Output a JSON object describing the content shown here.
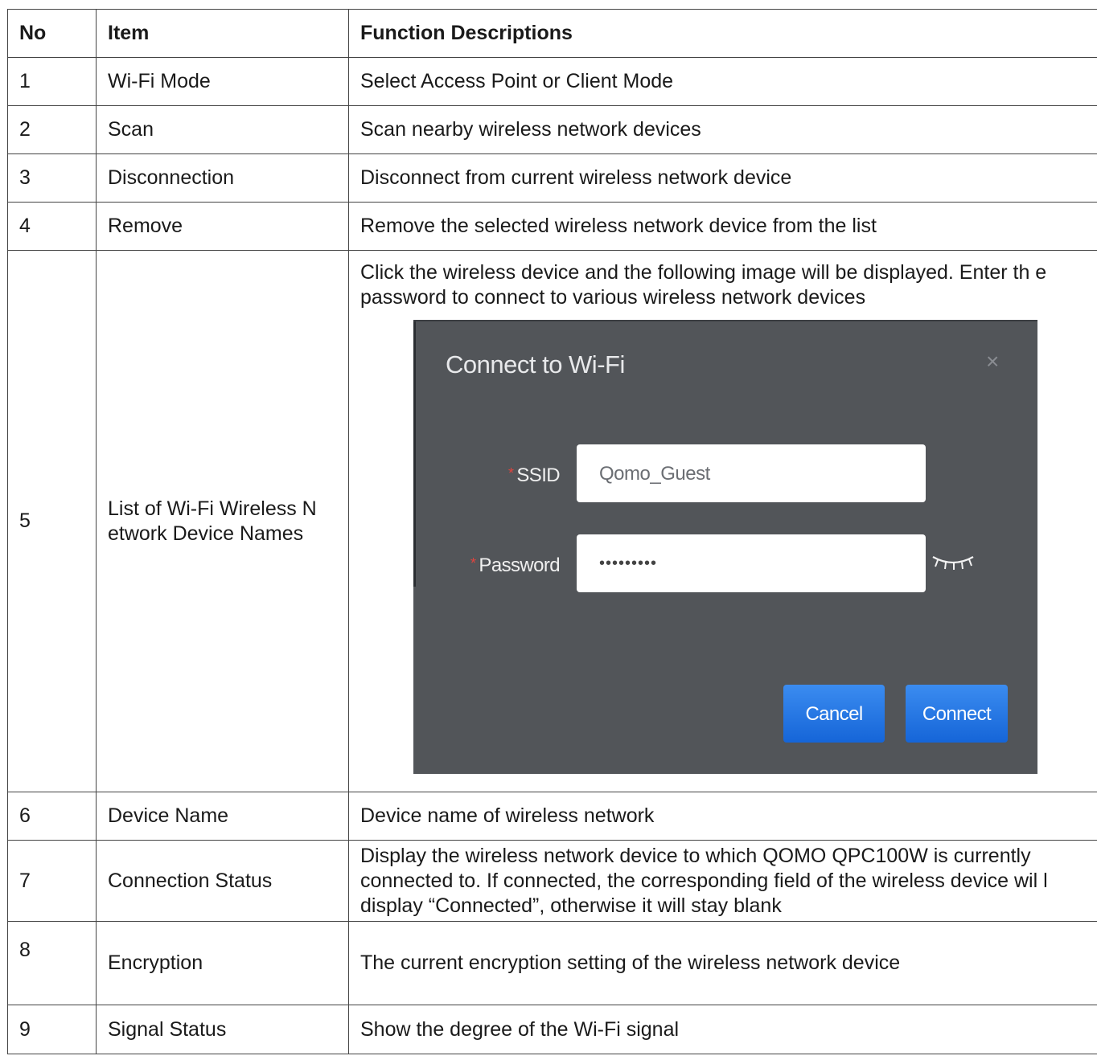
{
  "table": {
    "headers": {
      "no": "No",
      "item": "Item",
      "description": "Function Descriptions"
    },
    "rows": [
      {
        "no": "1",
        "item": "Wi-Fi Mode",
        "description": "Select Access Point or Client Mode"
      },
      {
        "no": "2",
        "item": "Scan",
        "description": "Scan nearby wireless network devices"
      },
      {
        "no": "3",
        "item": "Disconnection",
        "description": "Disconnect from current wireless network device"
      },
      {
        "no": "4",
        "item": "Remove",
        "description": "Remove the selected wireless network device from the list"
      },
      {
        "no": "5",
        "item": "List of Wi-Fi Wireless N etwork Device Names",
        "description": "Click the wireless device and the following image will be displayed. Enter th e password to connect to various wireless network devices"
      },
      {
        "no": "6",
        "item": "Device Name",
        "description": "Device name of wireless network"
      },
      {
        "no": "7",
        "item": "Connection Status",
        "description": "Display the wireless network device to which QOMO QPC100W is currently connected to. If connected, the corresponding field of the wireless device wil l display “Connected”, otherwise it will stay blank"
      },
      {
        "no": "8",
        "item": "Encryption",
        "description": "The current encryption setting of the wireless network device"
      },
      {
        "no": "9",
        "item": "Signal Status",
        "description": "Show the degree of the Wi-Fi signal"
      }
    ]
  },
  "dialog": {
    "title": "Connect to Wi-Fi",
    "close_glyph": "×",
    "required_marker": "*",
    "ssid_label": "SSID",
    "ssid_value": "Qomo_Guest",
    "password_label": "Password",
    "password_value": "•••••••••",
    "cancel_label": "Cancel",
    "connect_label": "Connect",
    "icons": {
      "close": "close-icon",
      "password_toggle": "eye-closed-icon"
    }
  },
  "colors": {
    "dialog_bg": "#525559",
    "button_blue": "#1e78e6",
    "required_red": "#e0443e"
  }
}
